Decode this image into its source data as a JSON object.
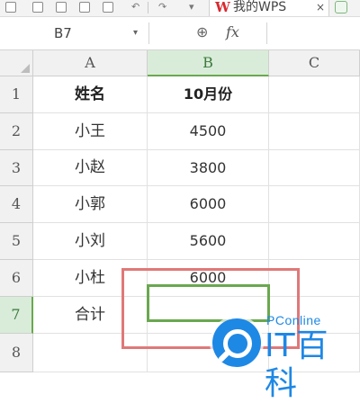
{
  "toolbar": {
    "tab_title": "我的WPS",
    "tab_logo": "W",
    "tab_close": "×"
  },
  "formula_bar": {
    "name_box_value": "B7",
    "name_box_caret": "▾",
    "zoom_glyph": "⊕",
    "fx_label": "fx",
    "formula_value": ""
  },
  "grid": {
    "columns": [
      "A",
      "B",
      "C"
    ],
    "rows": [
      "1",
      "2",
      "3",
      "4",
      "5",
      "6",
      "7",
      "8"
    ],
    "header_row": {
      "A": "姓名",
      "B": "10月份"
    },
    "data": [
      {
        "A": "小王",
        "B": "4500"
      },
      {
        "A": "小赵",
        "B": "3800"
      },
      {
        "A": "小郭",
        "B": "6000"
      },
      {
        "A": "小刘",
        "B": "5600"
      },
      {
        "A": "小杜",
        "B": "6000"
      },
      {
        "A": "合计",
        "B": ""
      }
    ],
    "active_cell": "B7"
  },
  "watermark": {
    "brand": "PConline",
    "logo_text": "IT百科"
  },
  "colors": {
    "selection": "#6aa84f",
    "annotation_frame": "#e07878",
    "watermark": "#1e88e5",
    "wps_red": "#d8292f"
  }
}
